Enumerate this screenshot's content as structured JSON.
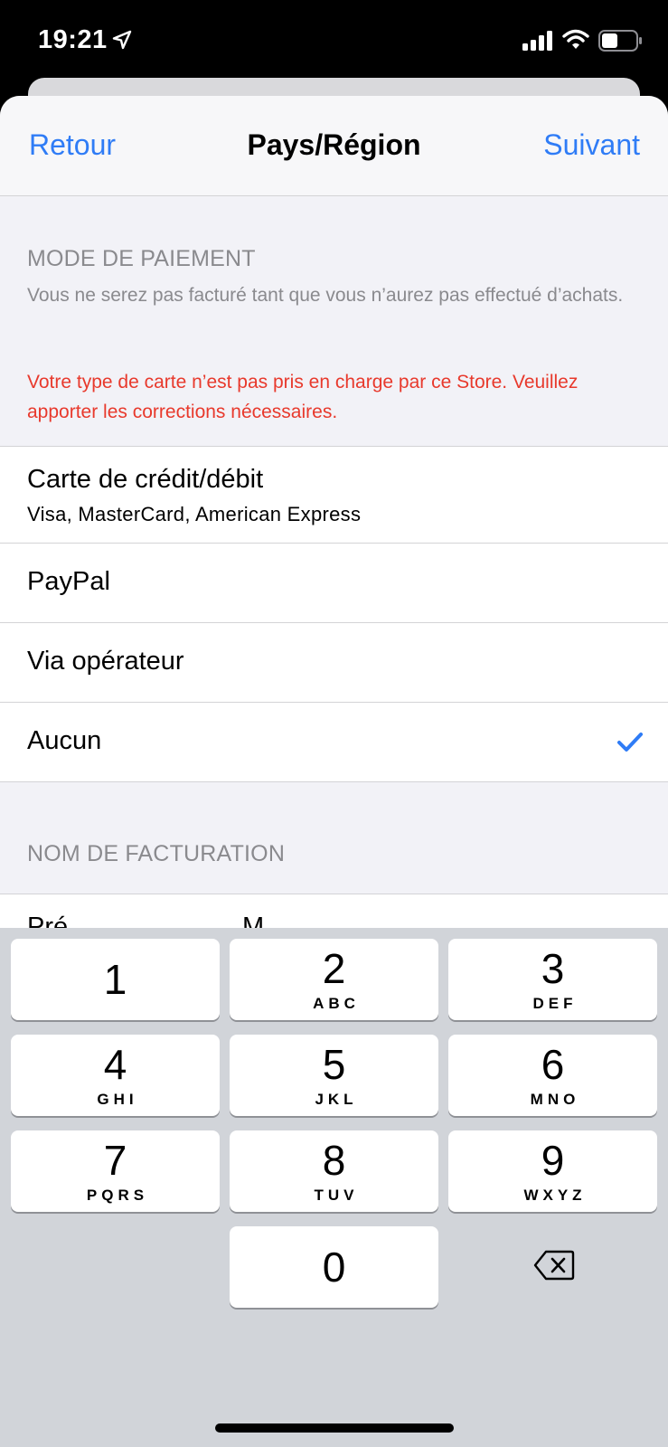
{
  "status_bar": {
    "time": "19:21"
  },
  "nav": {
    "back_label": "Retour",
    "title": "Pays/Région",
    "next_label": "Suivant"
  },
  "payment_section": {
    "header": "MODE DE PAIEMENT",
    "subtitle": "Vous ne serez pas facturé tant que vous n’aurez pas effectué d’achats.",
    "error": "Votre type de carte n’est pas pris en charge par ce Store. Veuillez apporter les corrections nécessaires.",
    "options": [
      {
        "title": "Carte de crédit/débit",
        "subtitle": "Visa, MasterCard, American Express"
      },
      {
        "title": "PayPal"
      },
      {
        "title": "Via opérateur"
      },
      {
        "title": "Aucun",
        "selected": true
      }
    ]
  },
  "billing_section": {
    "header": "NOM DE FACTURATION",
    "first_field_partial": "Pré",
    "second_field_partial": "M"
  },
  "keypad": {
    "keys": [
      {
        "digit": "1",
        "letters": ""
      },
      {
        "digit": "2",
        "letters": "ABC"
      },
      {
        "digit": "3",
        "letters": "DEF"
      },
      {
        "digit": "4",
        "letters": "GHI"
      },
      {
        "digit": "5",
        "letters": "JKL"
      },
      {
        "digit": "6",
        "letters": "MNO"
      },
      {
        "digit": "7",
        "letters": "PQRS"
      },
      {
        "digit": "8",
        "letters": "TUV"
      },
      {
        "digit": "9",
        "letters": "WXYZ"
      },
      {
        "digit": "0",
        "letters": ""
      }
    ],
    "delete_icon": "delete-backspace-icon"
  },
  "colors": {
    "accent": "#2f7cf6",
    "error": "#e8392c",
    "grouped_background": "#f2f2f7",
    "keypad_background": "#d1d4d9"
  }
}
